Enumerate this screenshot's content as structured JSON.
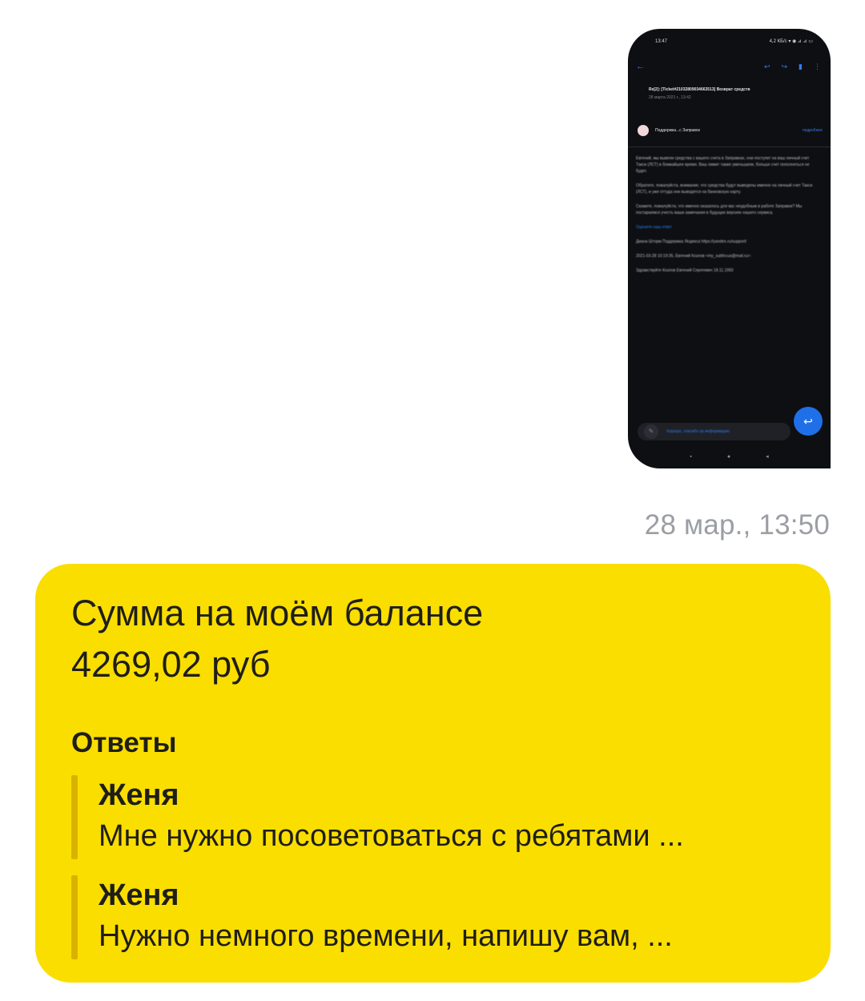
{
  "attachment": {
    "status_time": "13:47",
    "status_right": "4,2 КБ/с ▾ ◉ ⊿ ⊿ ▭",
    "subject": "Re[2]: [Ticket#21032809034663513] Возврат средств",
    "date": "28 марта 2021 г., 13:42",
    "sender": "Поддержка...с Заправок",
    "sender_link": "подробнее",
    "body_p1": "Евгений, мы вывели средства с вашего счета в Заправках, они поступят на ваш личный счет Такси (ЛСТ) в ближайшее время. Ваш лимит также уменьшили, больше счет пополняться не будет.",
    "body_p2": "Обратите, пожалуйста, внимание, что средства будут выведены именно на личный счет Такси (ЛСТ), и уже оттуда они выводятся на банковскую карту.",
    "body_p3": "Скажите, пожалуйста, что именно оказалось для вас неудобным в работе Заправок? Мы постараемся учесть ваши замечания в будущих версиях нашего сервиса.",
    "rate_link": "Оцените наш ответ",
    "signature": "Диана Шторм\nПоддержка Яндекса\nhttps://yandex.ru/support/",
    "quoted_header": "2021-03-28 10:19:35, Евгений Козлов <my_subfocus@mail.ru>:",
    "quoted_body": "Здравствуйте\nКозлов Евгений Сергеевич\n18.11.1993",
    "reply_placeholder": "Хорошо, спасибо за информацию",
    "nav_square": "▪",
    "nav_circle": "●",
    "nav_back": "◂"
  },
  "timestamp": "28 мар., 13:50",
  "message": {
    "line1": "Сумма на моём балансе",
    "line2": "4269,02 руб",
    "replies_title": "Ответы",
    "replies": [
      {
        "author": "Женя",
        "text": "Мне нужно посоветоваться с ребятами ..."
      },
      {
        "author": "Женя",
        "text": "Нужно немного времени, напишу вам, ..."
      }
    ]
  },
  "colors": {
    "bubble": "#fade00",
    "quote_line": "#d9b300",
    "timestamp": "#9b9ea3",
    "accent_blue": "#1f6fe8"
  }
}
